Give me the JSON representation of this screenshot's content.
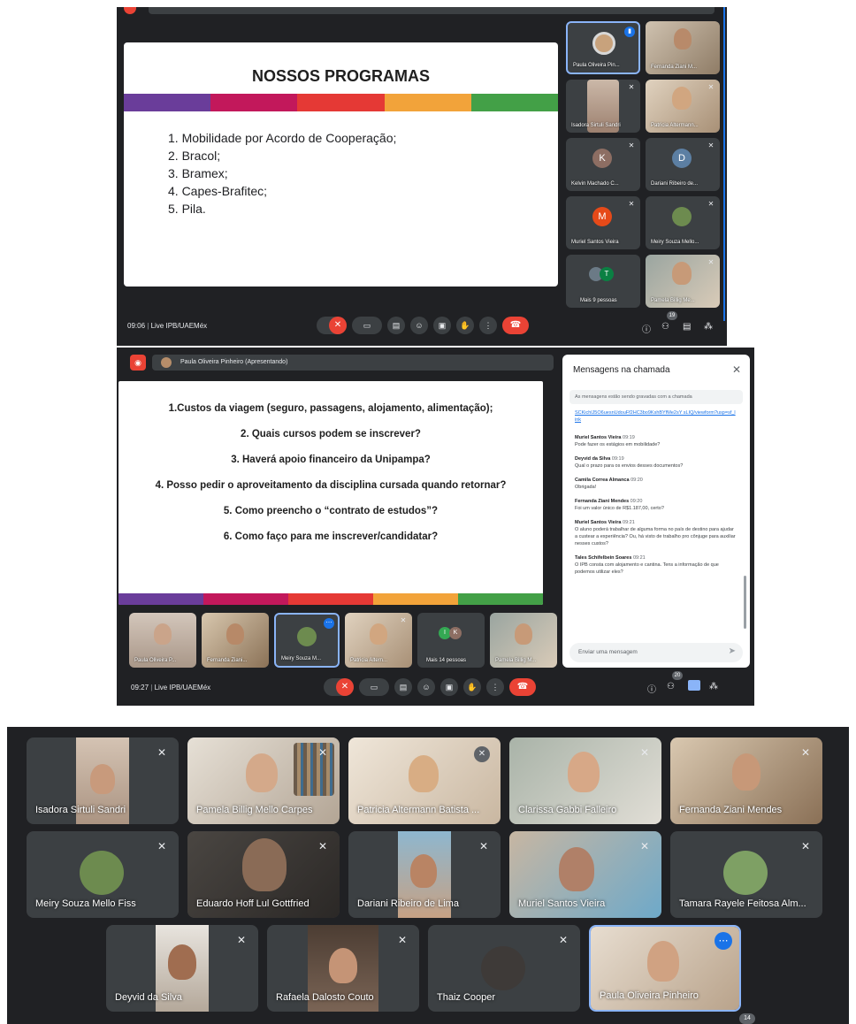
{
  "top_meeting": {
    "slide_title": "NOSSOS PROGRAMAS",
    "slide_items": [
      "1. Mobilidade por Acordo de Cooperação;",
      "2. Bracol;",
      "3. Bramex;",
      "4. Capes-Brafitec;",
      "5. Pila."
    ],
    "participants": [
      {
        "name": "Paula Oliveira Pin..."
      },
      {
        "name": "Fernanda Ziani M..."
      },
      {
        "name": "Isadora Sirtuli Sandri"
      },
      {
        "name": "Patricia Altermann..."
      },
      {
        "name": "Kelvin Machado C...",
        "initial": "K"
      },
      {
        "name": "Dariani Ribeiro de...",
        "initial": "D"
      },
      {
        "name": "Muriel Santos Vieira",
        "initial": "M"
      },
      {
        "name": "Meiry Souza Mello..."
      },
      {
        "name": "Mais 9 pessoas",
        "initial": "T"
      },
      {
        "name": "Pamela Billig Me..."
      }
    ],
    "time": "09:06",
    "meeting_name": "Live IPB/UAEMéx",
    "people_count": "19"
  },
  "bottom_meeting": {
    "presenter_label": "Paula Oliveira Pinheiro (Apresentando)",
    "slide_items": [
      "1.Custos da viagem (seguro, passagens, alojamento, alimentação);",
      "2. Quais cursos podem se inscrever?",
      "3. Haverá apoio financeiro da Unipampa?",
      "4. Posso pedir o aproveitamento da disciplina cursada quando retornar?",
      "5. Como preencho o “contrato de estudos”?",
      "6. Como faço para me inscrever/candidatar?"
    ],
    "filmstrip": [
      {
        "name": "Paula Oliveira P..."
      },
      {
        "name": "Fernanda Ziani..."
      },
      {
        "name": "Meiry Souza M..."
      },
      {
        "name": "Patricia Altern..."
      },
      {
        "name": "Mais 14 pessoas",
        "initials": [
          "I",
          "K"
        ]
      },
      {
        "name": "Pamela Billig M..."
      }
    ],
    "time": "09:27",
    "meeting_name": "Live IPB/UAEMéx",
    "people_count": "20",
    "chat": {
      "title": "Mensagens na chamada",
      "notice": "As mensagens estão sendo gravadas com a chamada",
      "link": "SCKichlJ5O6uesnUdouFf2HC3bo9KshBYfMe2sY sLIQ/viewform?usp=sf_link",
      "messages": [
        {
          "sender": "Muriel Santos Vieira",
          "time": "09:19",
          "text": "Pode fazer os estágios em mobilidade?"
        },
        {
          "sender": "Deyvid da Silva",
          "time": "09:19",
          "text": "Qual o prazo para os envios desses documentos?"
        },
        {
          "sender": "Camila Correa Almanca",
          "time": "09:20",
          "text": "Obrigada!"
        },
        {
          "sender": "Fernanda Ziani Mendes",
          "time": "09:20",
          "text": "Foi um valor único de R$1.187,00, certo?"
        },
        {
          "sender": "Muriel Santos Vieira",
          "time": "09:21",
          "text": "O aluno poderá trabalhar de alguma forma no país de destino para ajudar a custear a experiência? Ou, há visto de trabalho pro cônjuge para auxiliar nesses custos?"
        },
        {
          "sender": "Tales Schifelbein Soares",
          "time": "09:21",
          "text": "O IPB consta com alojamento e cantina. Tens a informação de que podemos utilizar eles?"
        }
      ],
      "input_placeholder": "Enviar uma mensagem"
    }
  },
  "gallery": {
    "tiles": [
      {
        "name": "Isadora Sirtuli Sandri"
      },
      {
        "name": "Pamela Billig Mello Carpes"
      },
      {
        "name": "Patricia Altermann Batista ..."
      },
      {
        "name": "Clarissa Gabbi Falleiro"
      },
      {
        "name": "Fernanda Ziani Mendes"
      },
      {
        "name": "Meiry Souza Mello Fiss"
      },
      {
        "name": "Eduardo Hoff Lul Gottfried"
      },
      {
        "name": "Dariani Ribeiro de Lima"
      },
      {
        "name": "Muriel Santos Vieira"
      },
      {
        "name": "Tamara Rayele Feitosa Alm..."
      },
      {
        "name": "Deyvid da Silva"
      },
      {
        "name": "Rafaela Dalosto Couto"
      },
      {
        "name": "Thaiz Cooper"
      },
      {
        "name": "Paula Oliveira Pinheiro"
      }
    ],
    "people_count": "14"
  },
  "colors": {
    "meet_bg": "#202124",
    "tile_bg": "#3c4043",
    "red": "#ea4335",
    "blue": "#1a73e8",
    "stripe": [
      "#6a3d9a",
      "#c2185b",
      "#e53935",
      "#f2a33a",
      "#43a047"
    ]
  }
}
